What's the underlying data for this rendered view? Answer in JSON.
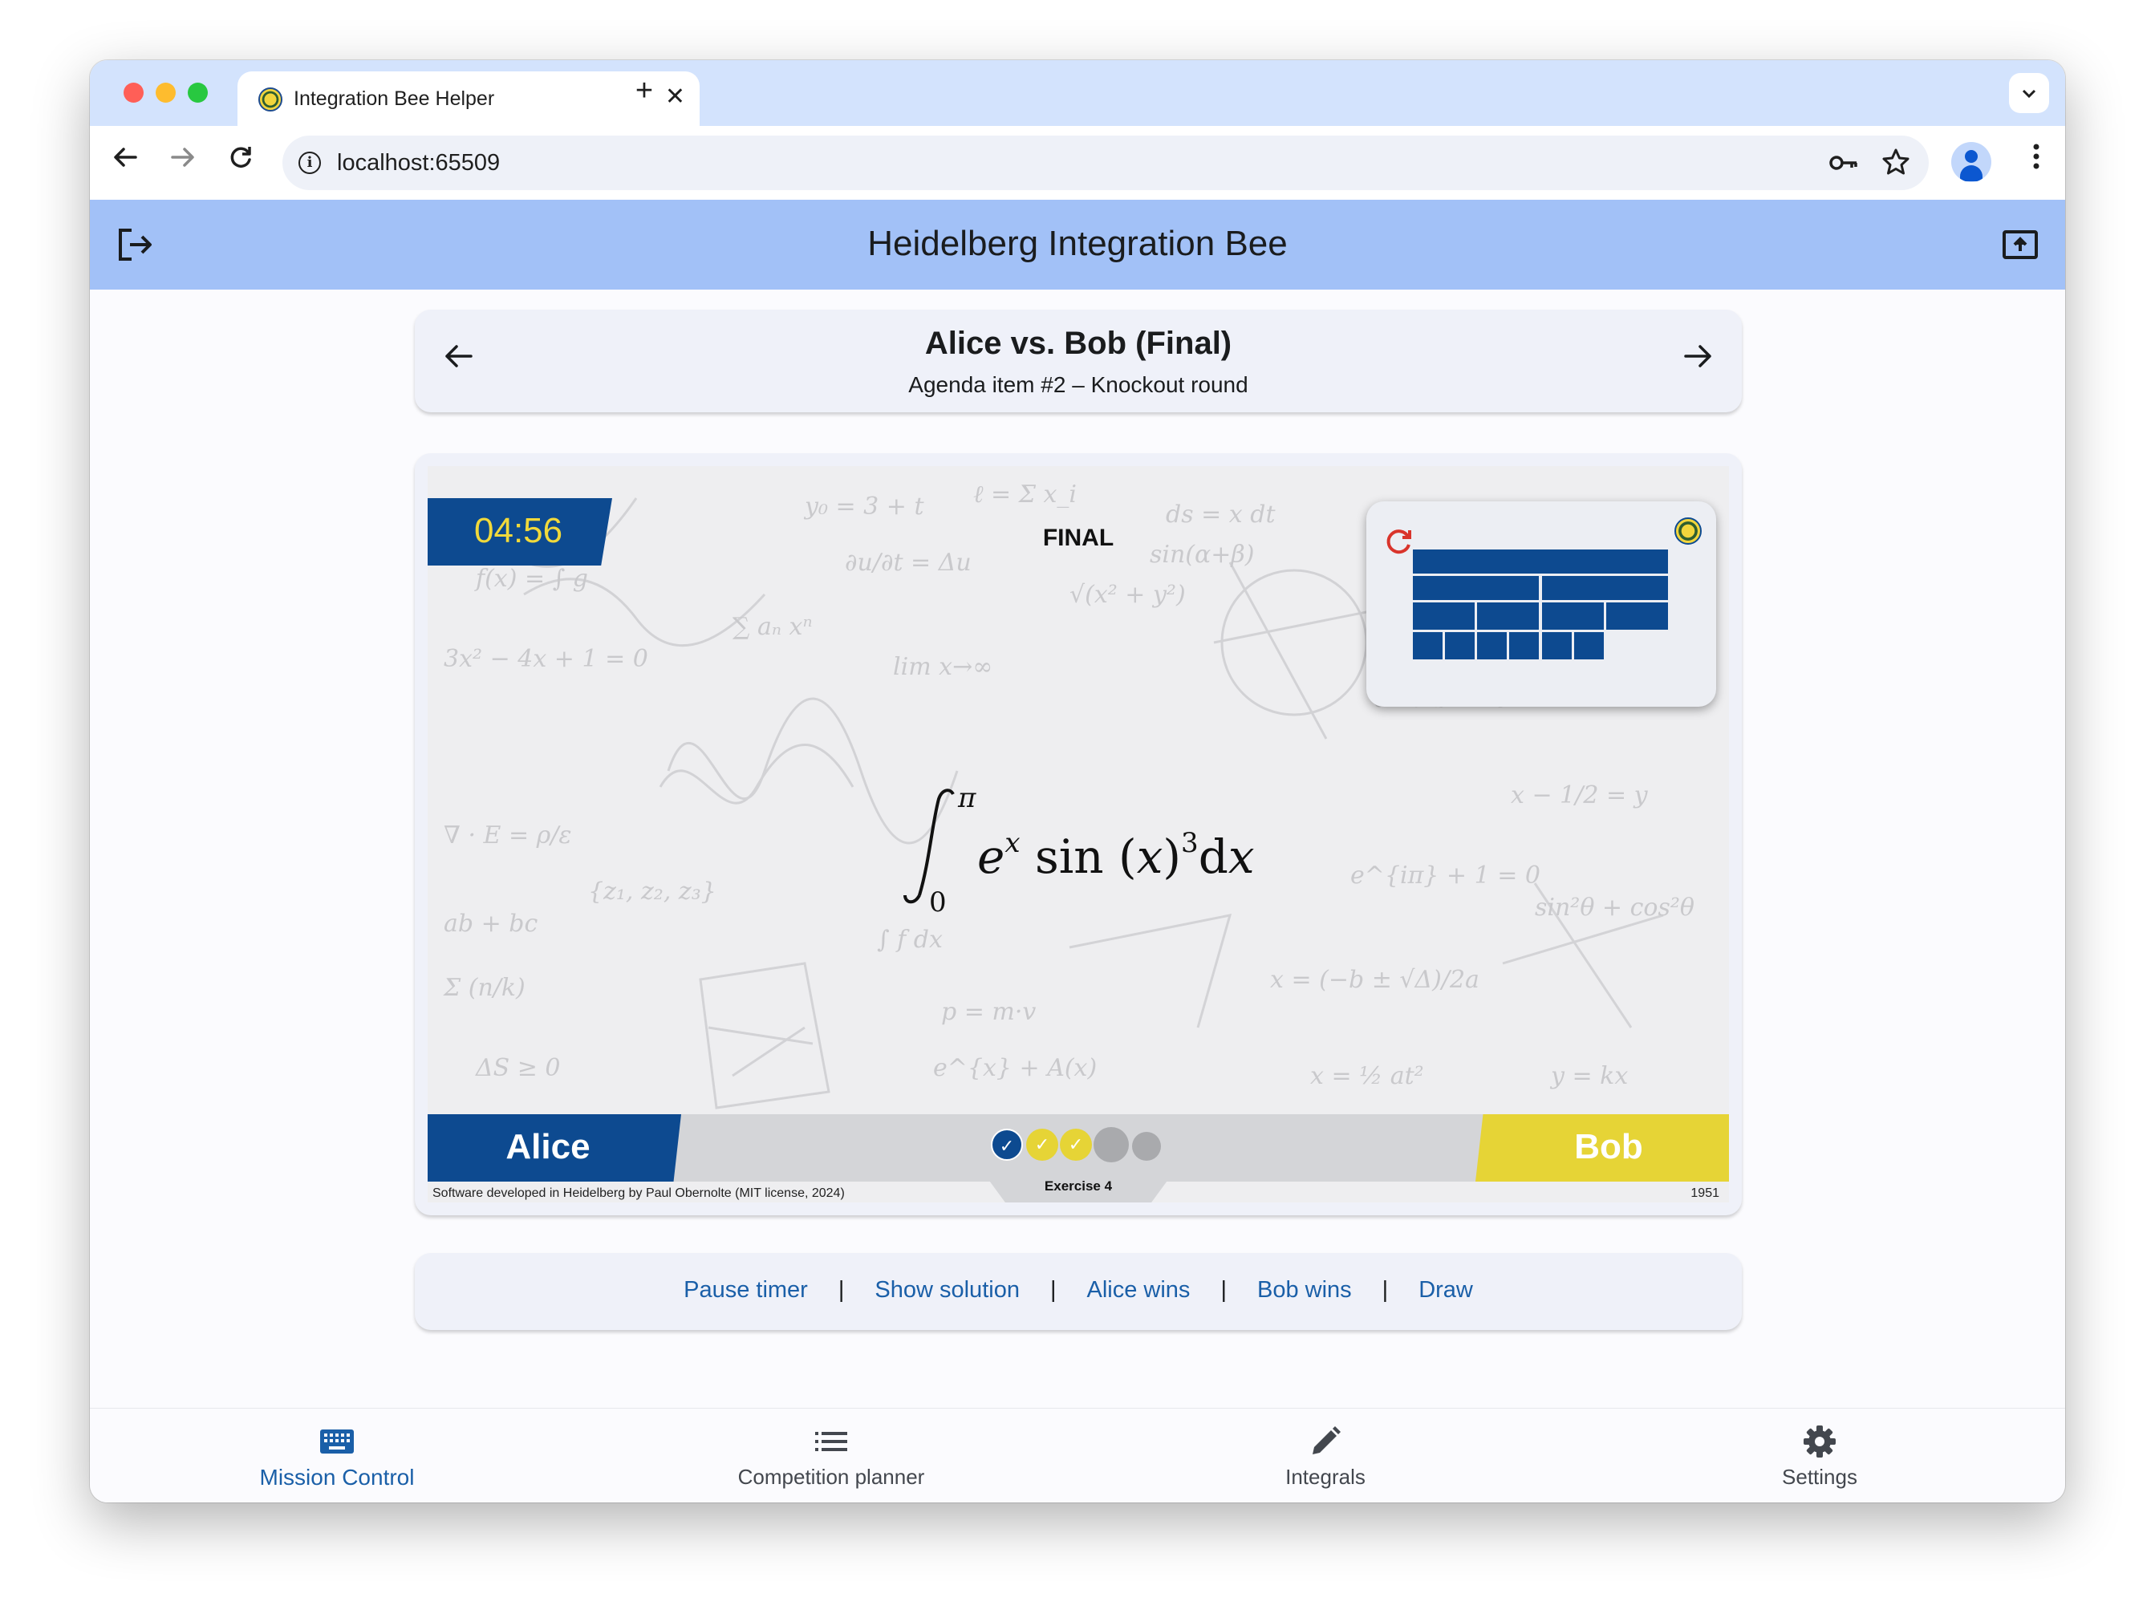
{
  "browser": {
    "tab_title": "Integration Bee Helper",
    "url": "localhost:65509"
  },
  "app": {
    "title": "Heidelberg Integration Bee"
  },
  "match": {
    "title": "Alice vs. Bob (Final)",
    "subtitle": "Agenda item #2 – Knockout round"
  },
  "stage": {
    "timer": "04:56",
    "round_label": "FINAL",
    "player_left": "Alice",
    "player_right": "Bob",
    "exercise_label": "Exercise 4",
    "footer_left": "Software developed in Heidelberg by Paul Obernolte (MIT license, 2024)",
    "footer_right": "1951",
    "progress_dots": [
      {
        "state": "done",
        "winner": "left",
        "color": "#0d4a90"
      },
      {
        "state": "done",
        "winner": "right",
        "color": "#e6d436"
      },
      {
        "state": "done",
        "winner": "right",
        "color": "#e6d436"
      },
      {
        "state": "current",
        "color": "#a9aaad"
      },
      {
        "state": "pending",
        "color": "#a9aaad"
      }
    ],
    "integral": {
      "lower": "0",
      "upper": "π",
      "integrand": "e^x sin(x)^3 dx"
    }
  },
  "actions": {
    "pause_timer": "Pause timer",
    "show_solution": "Show solution",
    "alice_wins": "Alice wins",
    "bob_wins": "Bob wins",
    "draw": "Draw",
    "separator": "|"
  },
  "nav": {
    "items": [
      {
        "label": "Mission Control",
        "icon": "keyboard-icon",
        "active": true
      },
      {
        "label": "Competition planner",
        "icon": "list-icon",
        "active": false
      },
      {
        "label": "Integrals",
        "icon": "pencil-icon",
        "active": false
      },
      {
        "label": "Settings",
        "icon": "gear-icon",
        "active": false
      }
    ]
  },
  "colors": {
    "app_bar": "#a2c1f7",
    "blue_player": "#0d4a90",
    "yellow_player": "#e6d436",
    "link": "#1a5fa8"
  }
}
